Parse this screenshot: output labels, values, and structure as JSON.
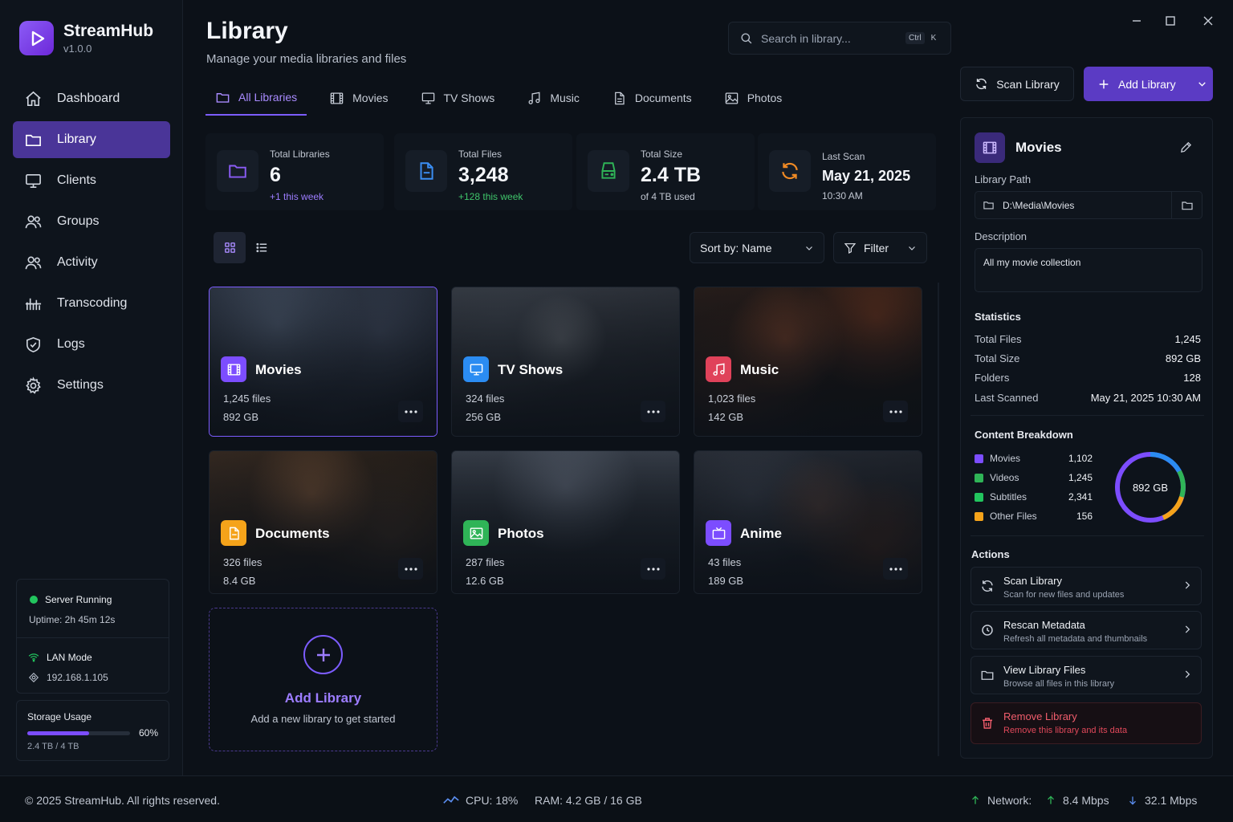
{
  "app": {
    "name": "StreamHub",
    "version": "v1.0.0"
  },
  "nav": [
    {
      "label": "Dashboard",
      "icon": "home-icon"
    },
    {
      "label": "Library",
      "icon": "folder-icon",
      "active": true
    },
    {
      "label": "Clients",
      "icon": "monitor-icon"
    },
    {
      "label": "Groups",
      "icon": "users-icon"
    },
    {
      "label": "Activity",
      "icon": "user-activity-icon"
    },
    {
      "label": "Transcoding",
      "icon": "transcode-icon"
    },
    {
      "label": "Logs",
      "icon": "shield-check-icon"
    },
    {
      "label": "Settings",
      "icon": "gear-icon"
    }
  ],
  "server": {
    "status": "Server Running",
    "uptime": "Uptime: 2h 45m 12s",
    "mode": "LAN Mode",
    "ip": "192.168.1.105"
  },
  "storage": {
    "label": "Storage Usage",
    "percent": 60,
    "percent_text": "60%",
    "detail": "2.4 TB / 4 TB"
  },
  "header": {
    "title": "Library",
    "subtitle": "Manage your media libraries and files"
  },
  "search": {
    "placeholder": "Search in library...",
    "key1": "Ctrl",
    "key2": "K"
  },
  "buttons": {
    "scan": "Scan Library",
    "add": "Add Library"
  },
  "tabs": [
    {
      "label": "All Libraries",
      "active": true
    },
    {
      "label": "Movies"
    },
    {
      "label": "TV Shows"
    },
    {
      "label": "Music"
    },
    {
      "label": "Documents"
    },
    {
      "label": "Photos"
    }
  ],
  "stats": [
    {
      "label": "Total Libraries",
      "value": "6",
      "note": "+1 this week"
    },
    {
      "label": "Total Files",
      "value": "3,248",
      "note": "+128 this week"
    },
    {
      "label": "Total Size",
      "value": "2.4 TB",
      "note": "of 4 TB used"
    },
    {
      "label": "Last Scan",
      "value": "May 21, 2025",
      "note": "10:30 AM"
    }
  ],
  "toolbar": {
    "sort": "Sort by: Name",
    "filter": "Filter"
  },
  "libraries": [
    {
      "name": "Movies",
      "files": "1,245 files",
      "size": "892 GB",
      "color": "#7c4dff"
    },
    {
      "name": "TV Shows",
      "files": "324 files",
      "size": "256 GB",
      "color": "#2b8cf2"
    },
    {
      "name": "Music",
      "files": "1,023 files",
      "size": "142 GB",
      "color": "#e0425a"
    },
    {
      "name": "Documents",
      "files": "326 files",
      "size": "8.4 GB",
      "color": "#f5a31a"
    },
    {
      "name": "Photos",
      "files": "287 files",
      "size": "12.6 GB",
      "color": "#2fb457"
    },
    {
      "name": "Anime",
      "files": "43 files",
      "size": "189 GB",
      "color": "#7c4dff"
    }
  ],
  "add_card": {
    "title": "Add Library",
    "subtitle": "Add a new library to get started"
  },
  "panel": {
    "title": "Movies",
    "path_label": "Library Path",
    "path": "D:\\Media\\Movies",
    "desc_label": "Description",
    "description": "All my movie collection",
    "stats_label": "Statistics",
    "stats": [
      {
        "k": "Total Files",
        "v": "1,245"
      },
      {
        "k": "Total Size",
        "v": "892 GB"
      },
      {
        "k": "Folders",
        "v": "128"
      },
      {
        "k": "Last Scanned",
        "v": "May 21, 2025 10:30 AM"
      }
    ],
    "breakdown_label": "Content Breakdown",
    "breakdown": [
      {
        "name": "Movies",
        "value": 1102,
        "value_text": "1,102",
        "color": "#7c4dff"
      },
      {
        "name": "Videos",
        "value": 1245,
        "value_text": "1,245",
        "color": "#2fb457"
      },
      {
        "name": "Subtitles",
        "value": 2341,
        "value_text": "2,341",
        "color": "#22c55e"
      },
      {
        "name": "Other Files",
        "value": 156,
        "value_text": "156",
        "color": "#f5a31a"
      }
    ],
    "donut_center": "892 GB",
    "actions_label": "Actions",
    "actions": [
      {
        "title": "Scan Library",
        "sub": "Scan for new files and updates"
      },
      {
        "title": "Rescan Metadata",
        "sub": "Refresh all metadata and thumbnails"
      },
      {
        "title": "View Library Files",
        "sub": "Browse all files in this library"
      },
      {
        "title": "Remove Library",
        "sub": "Remove this library and its data"
      }
    ]
  },
  "footer": {
    "copyright": "© 2025 StreamHub. All rights reserved.",
    "cpu": "CPU: 18%",
    "ram": "RAM: 4.2 GB / 16 GB",
    "network": "Network:",
    "up": "8.4 Mbps",
    "down": "32.1 Mbps"
  }
}
